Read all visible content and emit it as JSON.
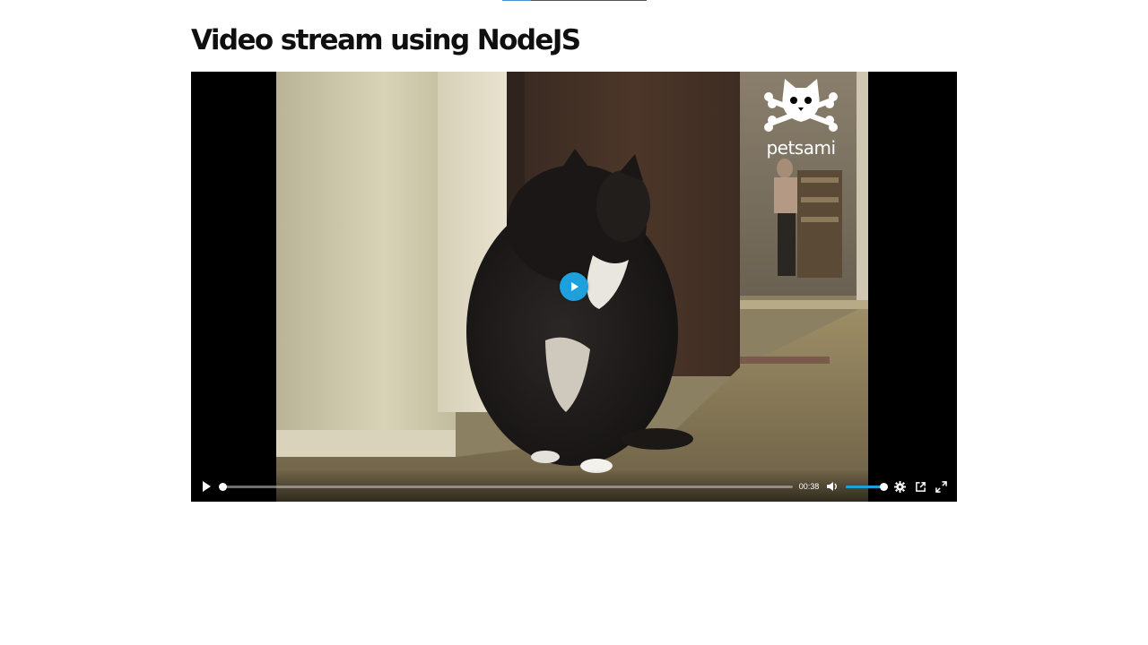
{
  "page": {
    "title": "Video stream using NodeJS"
  },
  "loading_bar": {
    "progress": 0.2
  },
  "player": {
    "logo_text": "petsami",
    "logo_icon": "cat-skull-crossbones-icon",
    "big_play_icon": "play-icon",
    "controls": {
      "play_icon": "play-icon",
      "progress": 0.0,
      "time": "00:38",
      "mute_icon": "volume-icon",
      "volume": 1.0,
      "settings_icon": "gear-icon",
      "pip_icon": "picture-in-picture-icon",
      "fullscreen_icon": "fullscreen-icon"
    },
    "accent_color": "#1ea0dc"
  }
}
